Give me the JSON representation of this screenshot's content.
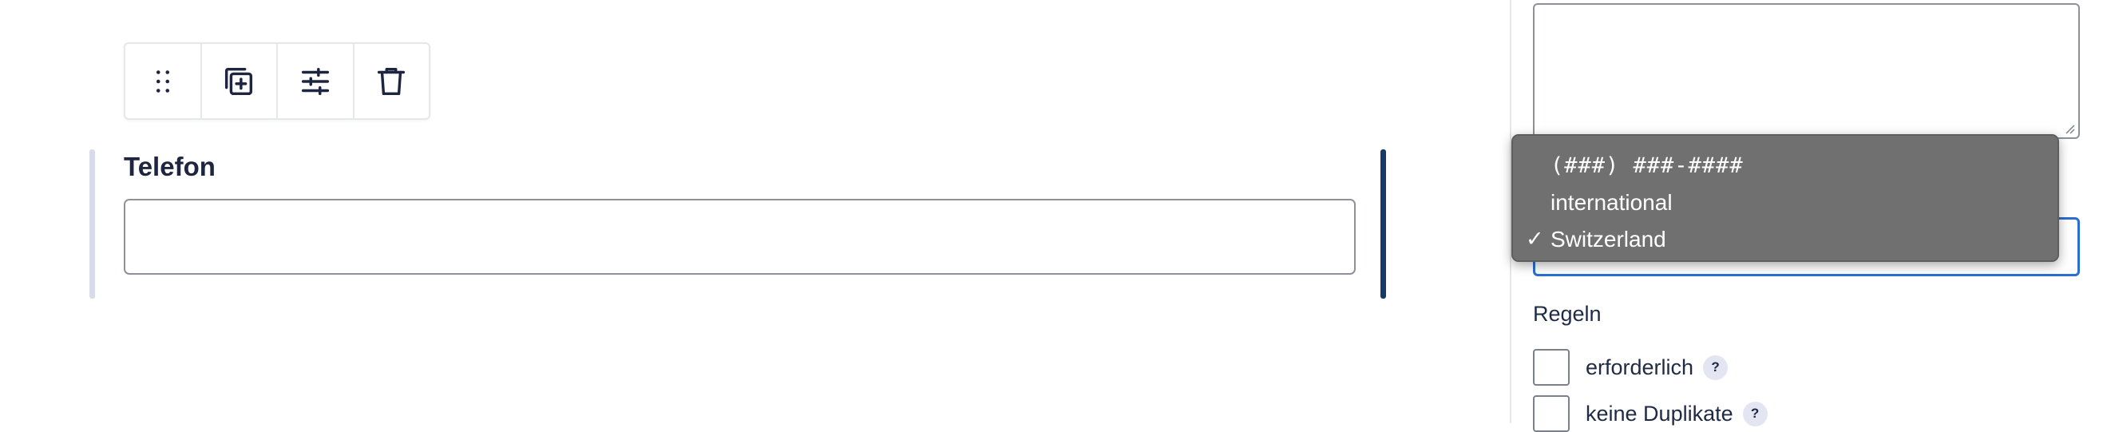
{
  "toolbar": {
    "buttons": [
      {
        "icon": "drag-handle-icon"
      },
      {
        "icon": "duplicate-icon"
      },
      {
        "icon": "settings-sliders-icon"
      },
      {
        "icon": "trash-icon"
      }
    ]
  },
  "field": {
    "label": "Telefon",
    "value": ""
  },
  "panel": {
    "textarea_value": "",
    "format_select": {
      "options": [
        "(###) ###-####",
        "international",
        "Switzerland"
      ],
      "selected": "Switzerland",
      "check_mark": "✓"
    },
    "rules": {
      "title": "Regeln",
      "items": [
        {
          "label": "erforderlich",
          "help": "?",
          "checked": false
        },
        {
          "label": "keine Duplikate",
          "help": "?",
          "checked": false
        }
      ]
    }
  },
  "colors": {
    "accent": "#163b66",
    "focus": "#2a6ed3",
    "dropdown_bg": "#707070"
  }
}
